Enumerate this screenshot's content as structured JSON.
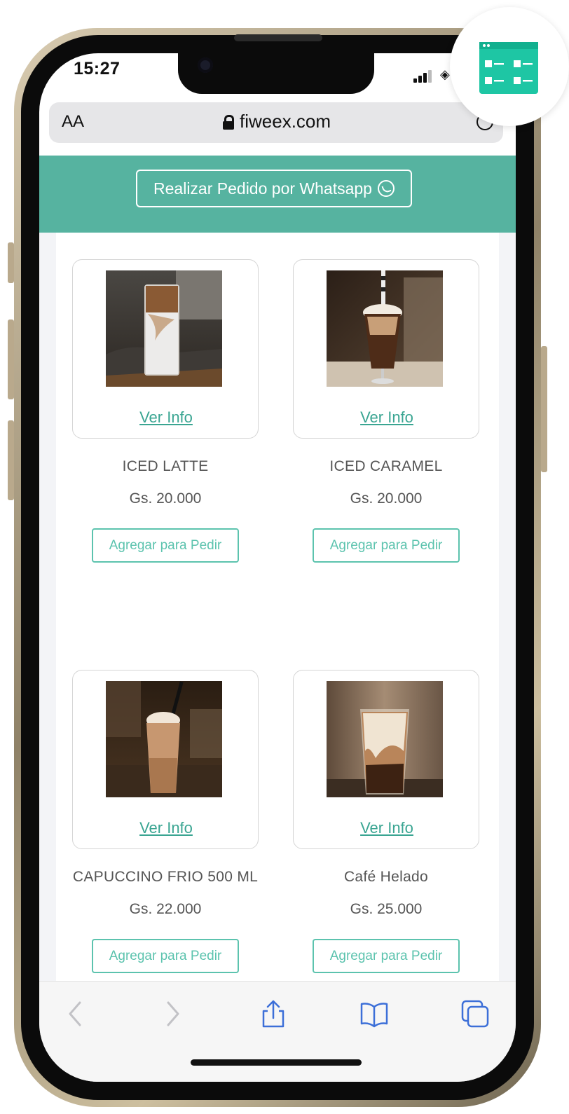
{
  "status_bar": {
    "time": "15:27"
  },
  "browser": {
    "text_size_label": "AA",
    "url": "fiweex.com"
  },
  "header": {
    "whatsapp_button_label": "Realizar Pedido por Whatsapp"
  },
  "products": [
    {
      "name": "ICED LATTE",
      "price": "Gs. 20.000",
      "info_label": "Ver Info",
      "add_label": "Agregar para Pedir"
    },
    {
      "name": "ICED CARAMEL",
      "price": "Gs. 20.000",
      "info_label": "Ver Info",
      "add_label": "Agregar para Pedir"
    },
    {
      "name": "CAPUCCINO FRIO 500 ML",
      "price": "Gs. 22.000",
      "info_label": "Ver Info",
      "add_label": "Agregar para Pedir"
    },
    {
      "name": "Café Helado",
      "price": "Gs. 25.000",
      "info_label": "Ver Info",
      "add_label": "Agregar para Pedir"
    }
  ],
  "toolbar": {
    "icons": [
      "back-icon",
      "forward-icon",
      "share-icon",
      "bookmarks-icon",
      "tabs-icon"
    ]
  },
  "colors": {
    "header_green": "#56b3a0",
    "accent_teal": "#5cc3ae",
    "link_teal": "#3aa592",
    "badge_green": "#1ec6a4"
  }
}
